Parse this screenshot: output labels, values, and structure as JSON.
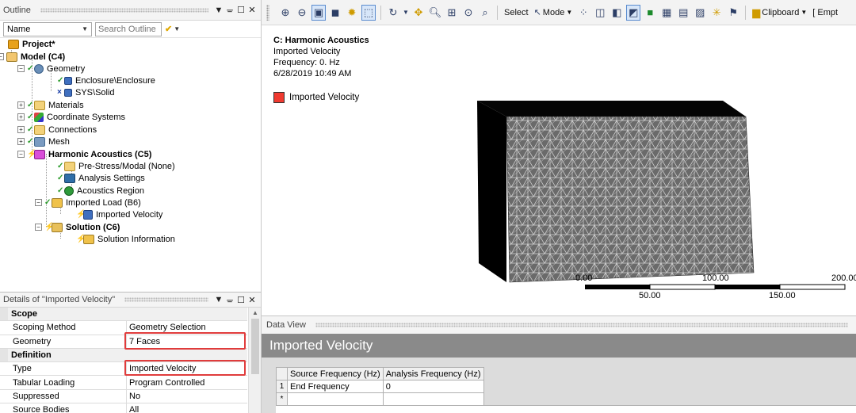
{
  "outline": {
    "title": "Outline",
    "controls": [
      "▼",
      "ᚚ",
      "☐",
      "✕"
    ],
    "filter_select": "Name",
    "search_placeholder": "Search Outline",
    "tree": [
      {
        "label": "Project*",
        "bold": true,
        "icon": "project-icon",
        "state": ""
      },
      {
        "label": "Model (C4)",
        "bold": true,
        "icon": "model-icon",
        "state": ""
      },
      {
        "label": "Geometry",
        "bold": false,
        "icon": "geometry-icon",
        "state": "check"
      },
      {
        "label": "Enclosure\\Enclosure",
        "bold": false,
        "icon": "solid-body-icon",
        "state": "check"
      },
      {
        "label": "SYS\\Solid",
        "bold": false,
        "icon": "solid-body-icon",
        "state": "x"
      },
      {
        "label": "Materials",
        "bold": false,
        "icon": "materials-icon",
        "state": "check"
      },
      {
        "label": "Coordinate Systems",
        "bold": false,
        "icon": "coordinate-systems-icon",
        "state": "check"
      },
      {
        "label": "Connections",
        "bold": false,
        "icon": "connections-icon",
        "state": "check"
      },
      {
        "label": "Mesh",
        "bold": false,
        "icon": "mesh-icon",
        "state": "check"
      },
      {
        "label": "Harmonic Acoustics (C5)",
        "bold": true,
        "icon": "harmonic-acoustics-icon",
        "state": "bolt"
      },
      {
        "label": "Pre-Stress/Modal (None)",
        "bold": false,
        "icon": "prestress-icon",
        "state": "check"
      },
      {
        "label": "Analysis Settings",
        "bold": false,
        "icon": "analysis-settings-icon",
        "state": "check"
      },
      {
        "label": "Acoustics Region",
        "bold": false,
        "icon": "acoustics-region-icon",
        "state": "check"
      },
      {
        "label": "Imported Load (B6)",
        "bold": false,
        "icon": "imported-load-icon",
        "state": "check"
      },
      {
        "label": "Imported Velocity",
        "bold": false,
        "icon": "imported-velocity-icon",
        "state": "bolt"
      },
      {
        "label": "Solution (C6)",
        "bold": true,
        "icon": "solution-icon",
        "state": "bolt"
      },
      {
        "label": "Solution Information",
        "bold": false,
        "icon": "solution-information-icon",
        "state": "bolt"
      }
    ]
  },
  "details": {
    "title": "Details of \"Imported Velocity\"",
    "rows": [
      {
        "type": "group",
        "key": "Scope",
        "value": ""
      },
      {
        "type": "row",
        "key": "Scoping Method",
        "value": "Geometry Selection"
      },
      {
        "type": "row",
        "key": "Geometry",
        "value": "7 Faces"
      },
      {
        "type": "group",
        "key": "Definition",
        "value": ""
      },
      {
        "type": "row",
        "key": "Type",
        "value": "Imported Velocity"
      },
      {
        "type": "row",
        "key": "Tabular Loading",
        "value": "Program Controlled"
      },
      {
        "type": "row",
        "key": "Suppressed",
        "value": "No"
      },
      {
        "type": "row",
        "key": "Source Bodies",
        "value": "All"
      }
    ]
  },
  "toolbar": {
    "select_label": "Select",
    "mode_label": "Mode",
    "clipboard_label": "Clipboard",
    "empty_label": "[ Empt"
  },
  "graphics": {
    "title": "C: Harmonic Acoustics",
    "line2": "Imported Velocity",
    "line3": "Frequency: 0. Hz",
    "line4": "6/28/2019 10:49 AM",
    "legend_label": "Imported Velocity",
    "legend_color": "#f03a30",
    "scale_top": [
      "0.00",
      "100.00",
      "200.00"
    ],
    "scale_bottom": [
      "50.00",
      "150.00"
    ]
  },
  "dataview": {
    "pane_title": "Data View",
    "header": "Imported Velocity",
    "columns": [
      "Source Frequency (Hz)",
      "Analysis Frequency (Hz)"
    ],
    "rows": [
      {
        "num": "1",
        "cells": [
          "End Frequency",
          "0"
        ]
      },
      {
        "num": "*",
        "cells": [
          "",
          ""
        ]
      }
    ]
  }
}
